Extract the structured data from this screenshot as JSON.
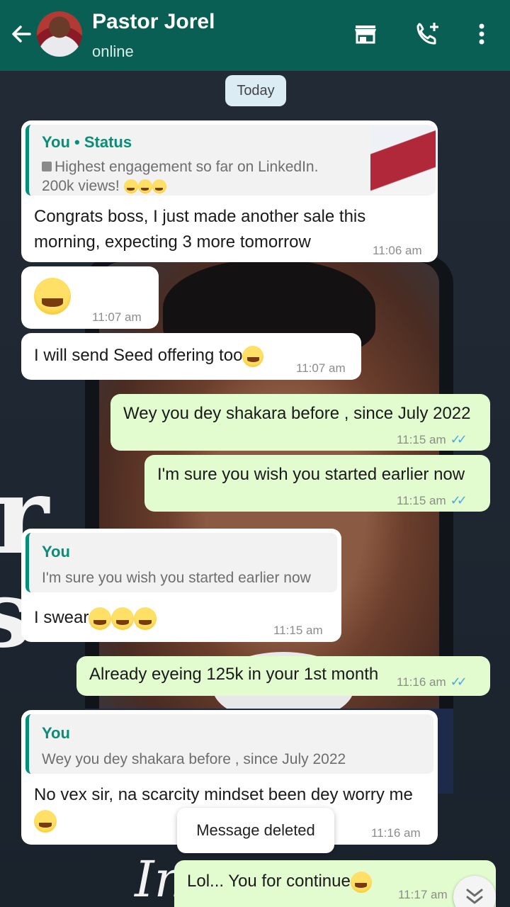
{
  "header": {
    "contact_name": "Pastor Jorel",
    "status": "online",
    "icons": [
      "back-arrow-icon",
      "store-icon",
      "add-call-icon",
      "more-vert-icon"
    ]
  },
  "date_chip": "Today",
  "messages": [
    {
      "direction": "in",
      "quote": {
        "title": "You • Status",
        "body_line1": "Highest engagement so far on LinkedIn.",
        "body_line2": "200k views!"
      },
      "text_line1": "Congrats boss, I just made another sale this",
      "text_line2": "morning, expecting 3 more tomorrow",
      "time": "11:06 am"
    },
    {
      "direction": "in",
      "emoji_only": true,
      "time": "11:07 am"
    },
    {
      "direction": "in",
      "text": "I will send Seed offering too",
      "time": "11:07 am"
    },
    {
      "direction": "out",
      "text": "Wey you dey shakara before , since July 2022",
      "time": "11:15 am",
      "status": "read"
    },
    {
      "direction": "out",
      "text": "I'm sure you wish you started earlier now",
      "time": "11:15 am",
      "status": "read"
    },
    {
      "direction": "in",
      "quote": {
        "title": "You",
        "body": "I'm sure you wish you started earlier now"
      },
      "text": "I swear",
      "time": "11:15 am"
    },
    {
      "direction": "out",
      "text": "Already eyeing 125k in your 1st month",
      "time": "11:16 am",
      "status": "read"
    },
    {
      "direction": "in",
      "quote": {
        "title": "You",
        "body": "Wey you dey shakara before , since July 2022"
      },
      "text": "No vex sir, na scarcity mindset been dey worry me",
      "time": "11:16 am"
    },
    {
      "direction": "out",
      "text": "Lol... You for continue",
      "time": "11:17 am",
      "status": "read"
    }
  ],
  "toast": "Message deleted",
  "colors": {
    "header": "#0a5f55",
    "incoming_bubble": "#ffffff",
    "outgoing_bubble": "#e2fcd0",
    "quote_accent": "#068f78",
    "read_ticks": "#4aa8e8"
  }
}
